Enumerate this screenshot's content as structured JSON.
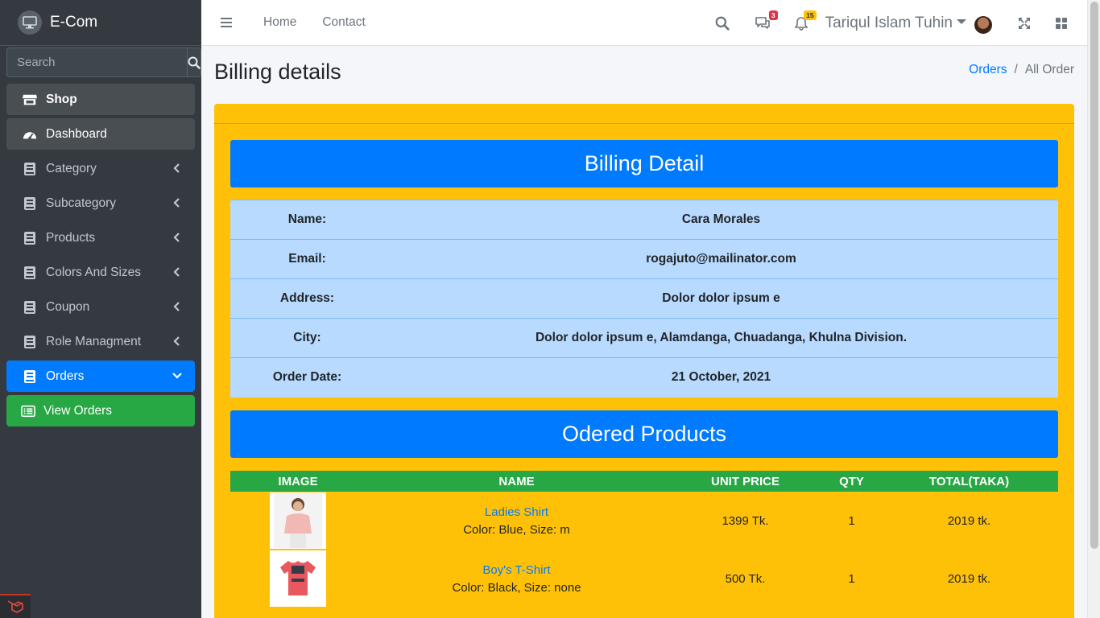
{
  "brand": {
    "name": "E-Com"
  },
  "sidebar": {
    "search_placeholder": "Search",
    "items": [
      {
        "label": "Shop"
      },
      {
        "label": "Dashboard"
      },
      {
        "label": "Category"
      },
      {
        "label": "Subcategory"
      },
      {
        "label": "Products"
      },
      {
        "label": "Colors And Sizes"
      },
      {
        "label": "Coupon"
      },
      {
        "label": "Role Managment"
      },
      {
        "label": "Orders"
      },
      {
        "label": "View Orders"
      }
    ]
  },
  "topbar": {
    "links": [
      "Home",
      "Contact"
    ],
    "messages_count": "3",
    "notifications_count": "15",
    "user_name": "Tariqul Islam Tuhin"
  },
  "page": {
    "title": "Billing details",
    "breadcrumb": {
      "link": "Orders",
      "sep": "/",
      "current": "All Order"
    }
  },
  "billing": {
    "heading": "Billing Detail",
    "rows": [
      {
        "label": "Name:",
        "value": "Cara Morales"
      },
      {
        "label": "Email:",
        "value": "rogajuto@mailinator.com"
      },
      {
        "label": "Address:",
        "value": "Dolor dolor ipsum e"
      },
      {
        "label": "City:",
        "value": "Dolor dolor ipsum e, Alamdanga, Chuadanga, Khulna Division."
      },
      {
        "label": "Order Date:",
        "value": "21 October, 2021"
      }
    ]
  },
  "products": {
    "heading": "Odered Products",
    "columns": [
      "IMAGE",
      "NAME",
      "UNIT PRICE",
      "QTY",
      "TOTAL(TAKA)"
    ],
    "rows": [
      {
        "name": "Ladies Shirt",
        "variant": "Color: Blue, Size: m",
        "unit_price": "1399 Tk.",
        "qty": "1",
        "total": "2019 tk."
      },
      {
        "name": "Boy's T-Shirt",
        "variant": "Color: Black, Size: none",
        "unit_price": "500 Tk.",
        "qty": "1",
        "total": "2019 tk."
      }
    ]
  },
  "colors": {
    "sidebar": "#343a40",
    "primary": "#007bff",
    "success": "#28a745",
    "warning": "#ffc107",
    "info_light": "#b8daff"
  }
}
